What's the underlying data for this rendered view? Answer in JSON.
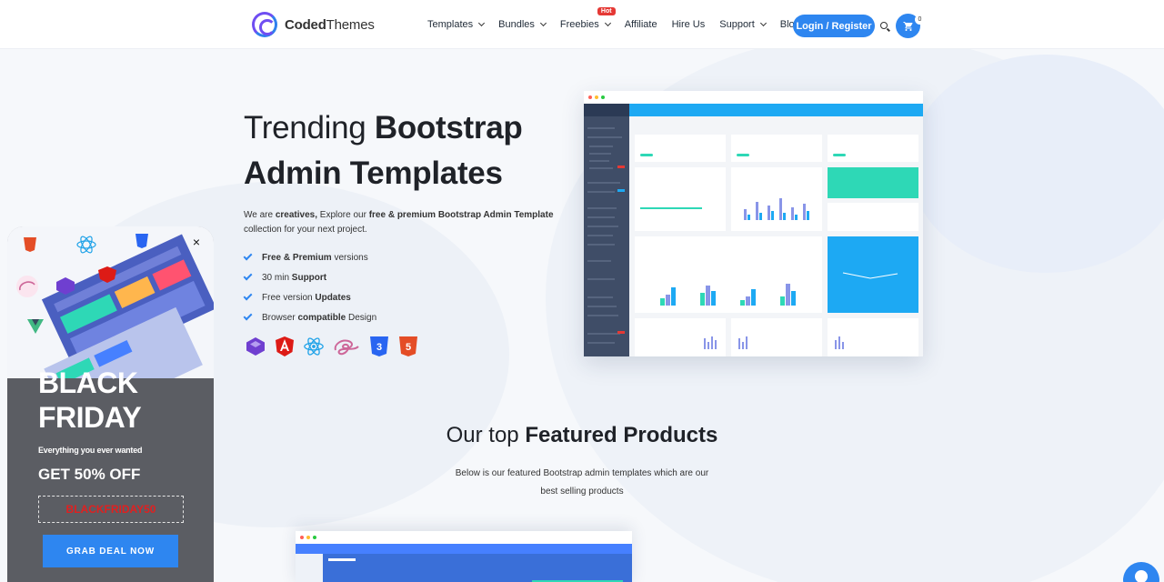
{
  "colors": {
    "accent": "#2e86f0",
    "promo_code": "#e02020",
    "promo_bg": "#5b5d63"
  },
  "nav": {
    "logo_bold": "Coded",
    "logo_thin": "Themes",
    "items": [
      {
        "label": "Templates",
        "dropdown": true
      },
      {
        "label": "Bundles",
        "dropdown": true
      },
      {
        "label": "Freebies",
        "dropdown": true,
        "badge": "Hot"
      },
      {
        "label": "Affiliate",
        "dropdown": false
      },
      {
        "label": "Hire Us",
        "dropdown": false
      },
      {
        "label": "Support",
        "dropdown": true
      },
      {
        "label": "Blog",
        "dropdown": false
      }
    ],
    "login_label": "Login / Register",
    "cart_count": "0"
  },
  "hero": {
    "title_prefix": "Trending ",
    "title_bold_1": "Bootstrap",
    "title_line2": "Admin Templates",
    "desc_1": "We are ",
    "desc_bold_1": "creatives,",
    "desc_2": " Explore our ",
    "desc_bold_2": "free & premium Bootstrap Admin Template",
    "desc_3": " collection for your next project.",
    "features": [
      {
        "bold": "Free & Premium",
        "rest": " versions",
        "bold_first": true
      },
      {
        "pre": "30 min ",
        "bold": "Support"
      },
      {
        "pre": "Free version ",
        "bold": "Updates"
      },
      {
        "pre": "Browser ",
        "bold": "compatible",
        "rest": " Design"
      }
    ],
    "tech_icons": [
      "bootstrap-icon",
      "angular-icon",
      "react-icon",
      "sass-icon",
      "css3-icon",
      "html5-icon"
    ]
  },
  "featured": {
    "title_prefix": "Our top ",
    "title_bold": "Featured Products",
    "subtitle": "Below is our featured Bootstrap admin templates which are our best selling products"
  },
  "promo": {
    "heading_line1": "BLACK",
    "heading_line2": "FRIDAY",
    "tagline": "Everything you ever wanted",
    "discount": "GET 50% OFF",
    "code": "BLACKFRIDAY50",
    "button": "GRAB DEAL NOW",
    "close": "×"
  }
}
